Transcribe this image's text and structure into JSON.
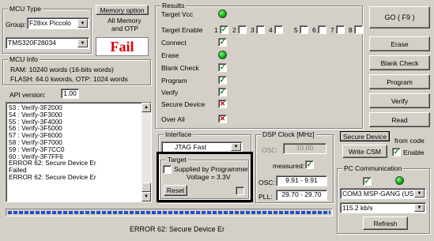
{
  "mcu_type": {
    "title": "MCU Type",
    "group_label": "Group:",
    "group_value": "F28xx Piccolo",
    "device_value": "TMS320F28034"
  },
  "memory_option": {
    "title": "Memory option",
    "value_line1": "All Memory",
    "value_line2": "and OTP"
  },
  "fail_label": "Fail",
  "mcu_info": {
    "title": "MCU Info",
    "ram": "RAM: 10240 words (16-bits words)",
    "flash": "FLASH:  64.0 kwords,  OTP: 1024 words"
  },
  "api": {
    "label": "API version:",
    "value": "1.00"
  },
  "log_lines": [
    "53 : Verify-3F2000",
    "54 : Verify-3F3000",
    "55 : Verify-3F4000",
    "56 : Verify-3F5000",
    "57 : Verify-3F6000",
    "58 : Verify-3F7000",
    "59 : Verify-3F7CC0",
    "60 : Verify-3F7FF6",
    "ERROR 62: Secure Device Er",
    "Failed",
    "ERROR 62: Secure Device Er"
  ],
  "results": {
    "title": "Results",
    "target_vcc": "Target Vcc",
    "target_enable": "Target Enable",
    "connect": "Connect",
    "erase": "Erase",
    "blank_check": "Blank Check",
    "program": "Program",
    "verify": "Verify",
    "secure_device": "Secure Device",
    "over_all": "Over All",
    "enable_numbers": [
      "1",
      "2",
      "3",
      "4",
      "5",
      "6",
      "7",
      "8"
    ],
    "check_mark": "✓",
    "cross_mark": "✕"
  },
  "buttons": {
    "go": "GO    ( F9 )",
    "erase": "Erase",
    "blank_check": "Blank Check",
    "program": "Program",
    "verify": "Verify",
    "read": "Read",
    "secure_device": "Secure Device",
    "write_csm": "Write CSM",
    "reset": "Reset",
    "refresh": "Refresh"
  },
  "from_code": {
    "label": "from code",
    "enable_label": "Enable"
  },
  "interface": {
    "title": "Interface",
    "value": "JTAG Fast"
  },
  "target": {
    "title": "Target",
    "supplied_label": "Supplied by Programmer",
    "voltage": "Voltage = 3.3V"
  },
  "dsp_clock": {
    "title": "DSP Clock [MHz]",
    "osc_label": "OSC:",
    "osc_value": "10.00",
    "measured_label": "measured:",
    "osc2_label": "OSC:",
    "osc2_value": "9.91 - 9.91",
    "pll_label": "PLL:",
    "pll_value": "29.70 - 29.70"
  },
  "pc_comm": {
    "title": "PC Communication",
    "port_value": "COM3   MSP-GANG (USB)",
    "baud_value": "115.2 kb/s"
  },
  "status_text": "ERROR 62: Secure Device Er",
  "progress_fraction": 1.0,
  "colors": {
    "fail_red": "#e00000",
    "led_green": "#00b000",
    "progress_blue": "#2050c8"
  },
  "icons": {
    "dropdown": "▼",
    "scroll_up": "▲",
    "scroll_down": "▼"
  }
}
